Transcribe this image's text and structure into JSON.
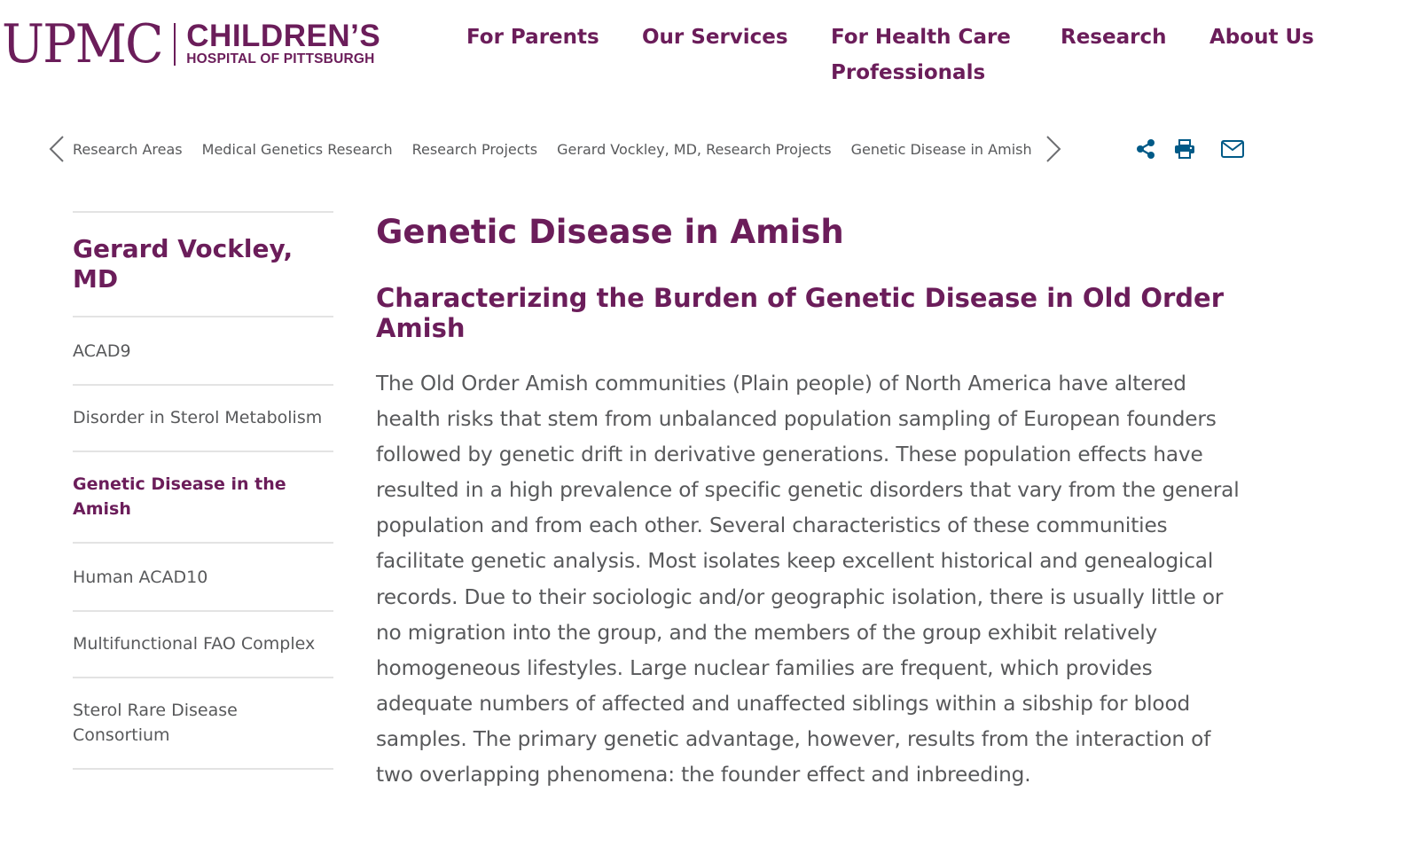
{
  "logo": {
    "upmc": "UPMC",
    "childrens": "CHILDREN’S",
    "hospital": "HOSPITAL OF PITTSBURGH"
  },
  "nav": {
    "for_parents": "For Parents",
    "our_services": "Our Services",
    "for_hcp": "For Health Care Professionals",
    "research": "Research",
    "about_us": "About Us"
  },
  "breadcrumb": {
    "items": [
      "Research Areas",
      "Medical Genetics Research",
      "Research Projects",
      "Gerard Vockley, MD, Research Projects",
      "Genetic Disease in Amish"
    ],
    "prev_icon": "chevron-left-icon",
    "next_icon": "chevron-right-icon"
  },
  "tools": {
    "share_icon": "share-icon",
    "print_icon": "print-icon",
    "email_icon": "email-icon",
    "icon_color": "#005a87"
  },
  "sidebar": {
    "title": "Gerard Vockley, MD",
    "items": [
      {
        "label": "ACAD9",
        "active": false
      },
      {
        "label": "Disorder in Sterol Metabolism",
        "active": false
      },
      {
        "label": "Genetic Disease in the Amish",
        "active": true
      },
      {
        "label": "Human ACAD10",
        "active": false
      },
      {
        "label": "Multifunctional FAO Complex",
        "active": false
      },
      {
        "label": "Sterol Rare Disease Consortium",
        "active": false
      }
    ]
  },
  "content": {
    "title": "Genetic Disease in Amish",
    "subtitle": "Characterizing the Burden of Genetic Disease in Old Order Amish",
    "body": "The Old Order Amish communities (Plain people) of North America have altered health risks that stem from unbalanced population sampling of European founders followed by genetic drift in derivative generations. These population effects have resulted in a high prevalence of specific genetic disorders that vary from the general population and from each other. Several characteristics of these communities facilitate genetic analysis. Most isolates keep excellent historical and genealogical records. Due to their sociologic and/or geographic isolation, there is usually little or no migration into the group, and the members of the group exhibit relatively homogeneous lifestyles. Large nuclear families are frequent, which provides adequate numbers of affected and unaffected siblings within a sibship for blood samples. The primary genetic advantage, however, results from the interaction of two overlapping phenomena: the founder effect and inbreeding."
  },
  "colors": {
    "brand": "#6b1d5a",
    "text": "#58595b",
    "rule": "#e3e3e3"
  }
}
